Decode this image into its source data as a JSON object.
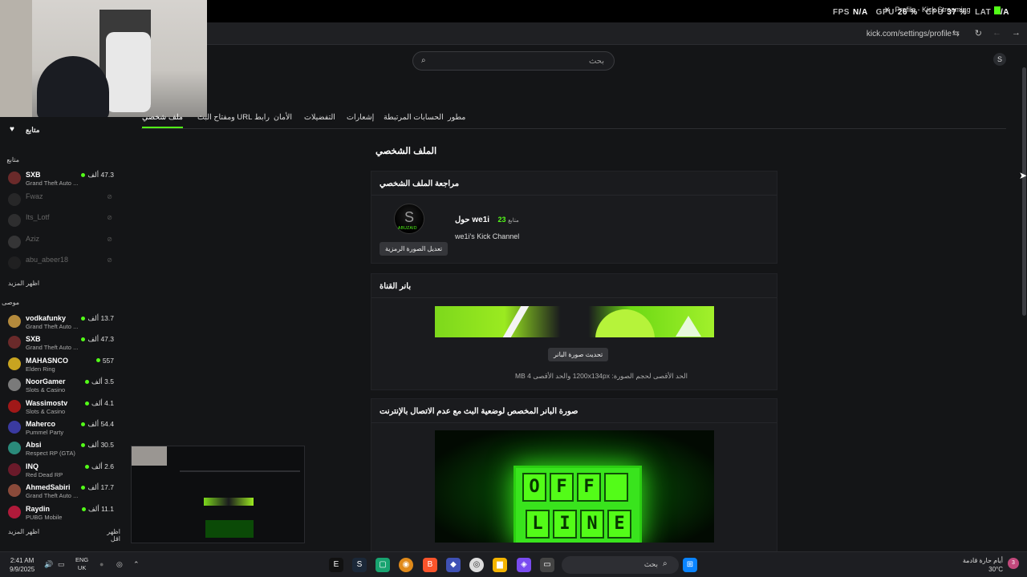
{
  "overlay": {
    "fps_label": "FPS",
    "fps_value": "N/A",
    "gpu_label": "GPU",
    "gpu_value": "26 %",
    "cpu_label": "CPU",
    "cpu_value": "37 %",
    "lat_label": "LAT",
    "lat_value": "N/A",
    "tab_title": "Profile - Kick Streaming"
  },
  "browser": {
    "url": "kick.com/settings/profile"
  },
  "search": {
    "placeholder": "بحث"
  },
  "sidebar": {
    "title": "متابع",
    "following_label": "متابع",
    "followed": [
      {
        "name": "SXB",
        "game": "Grand Theft Auto ...",
        "viewers": "47.3 ألف",
        "live": true,
        "color": "#6a2a2a"
      },
      {
        "name": "Fwaz",
        "live": false,
        "color": "#444"
      },
      {
        "name": "Its_Lotf",
        "live": false,
        "color": "#555"
      },
      {
        "name": "Aziz",
        "live": false,
        "color": "#666"
      },
      {
        "name": "abu_abeer18",
        "live": false,
        "color": "#333"
      }
    ],
    "show_more": "اظهر المزيد",
    "recommended_label": "موصى بها",
    "recommended": [
      {
        "name": "vodkafunky",
        "game": "Grand Theft Auto ...",
        "viewers": "13.7 ألف",
        "color": "#b48a3c"
      },
      {
        "name": "SXB",
        "game": "Grand Theft Auto ...",
        "viewers": "47.3 ألف",
        "color": "#6a2a2a"
      },
      {
        "name": "MAHASNCO",
        "game": "Elden Ring",
        "viewers": "557",
        "color": "#c8a420"
      },
      {
        "name": "NoorGamer",
        "game": "Slots & Casino",
        "viewers": "3.5 ألف",
        "color": "#7a7a7a"
      },
      {
        "name": "Wassimostv",
        "game": "Slots & Casino",
        "viewers": "4.1 ألف",
        "color": "#a01818"
      },
      {
        "name": "Maherco",
        "game": "Pummel Party",
        "viewers": "54.4 ألف",
        "color": "#3a3aa0"
      },
      {
        "name": "Absi",
        "game": "Respect RP (GTA)",
        "viewers": "30.5 ألف",
        "color": "#2a8a7a"
      },
      {
        "name": "INQ",
        "game": "Red Dead RP",
        "viewers": "2.6 ألف",
        "color": "#6a1a2a"
      },
      {
        "name": "AhmedSabiri",
        "game": "Grand Theft Auto ...",
        "viewers": "17.7 ألف",
        "color": "#8a4a3a"
      },
      {
        "name": "Raydin",
        "game": "PUBG Mobile",
        "viewers": "11.1 ألف",
        "color": "#b01a3a"
      }
    ],
    "show_more_bottom": "اظهر المزيد",
    "show_less": "اظهر اقل"
  },
  "tabs": [
    {
      "label": "ملف شخصي",
      "active": true
    },
    {
      "label": "رابط URL ومفتاح البث"
    },
    {
      "label": "الأمان"
    },
    {
      "label": "التفضيلات"
    },
    {
      "label": "إشعارات"
    },
    {
      "label": "الحسابات المرتبطة"
    },
    {
      "label": "مطور"
    }
  ],
  "main": {
    "page_title": "الملف الشخصي",
    "review_title": "مراجعة الملف الشخصي",
    "avatar_brand": "ABUZAID",
    "username": "we1i حول",
    "followers_count": "23",
    "followers_label": "متابع",
    "bio": "we1i's Kick Channel",
    "edit_avatar": "تعديل الصورة الرمزية",
    "banner_title": "بانر القناة",
    "update_banner": "تحديث صورة البانر",
    "banner_note": "الحد الأقصى لحجم الصورة: 1200x134px والحد الأقصى 4 MB",
    "offline_title": "صورة البانر المخصص لوضعية البث مع عدم الاتصال بالإنترنت",
    "offline_row1": [
      "O",
      "F",
      "F",
      ""
    ],
    "offline_row2": [
      "",
      "L",
      "I",
      "N",
      "E"
    ]
  },
  "taskbar": {
    "time": "2:41 AM",
    "date": "9/9/2025",
    "lang1": "ENG",
    "lang2": "UK",
    "search_placeholder": "بحث",
    "weather_text": "أيام حارة قادمة",
    "temperature": "30°C",
    "notifications": "3"
  }
}
